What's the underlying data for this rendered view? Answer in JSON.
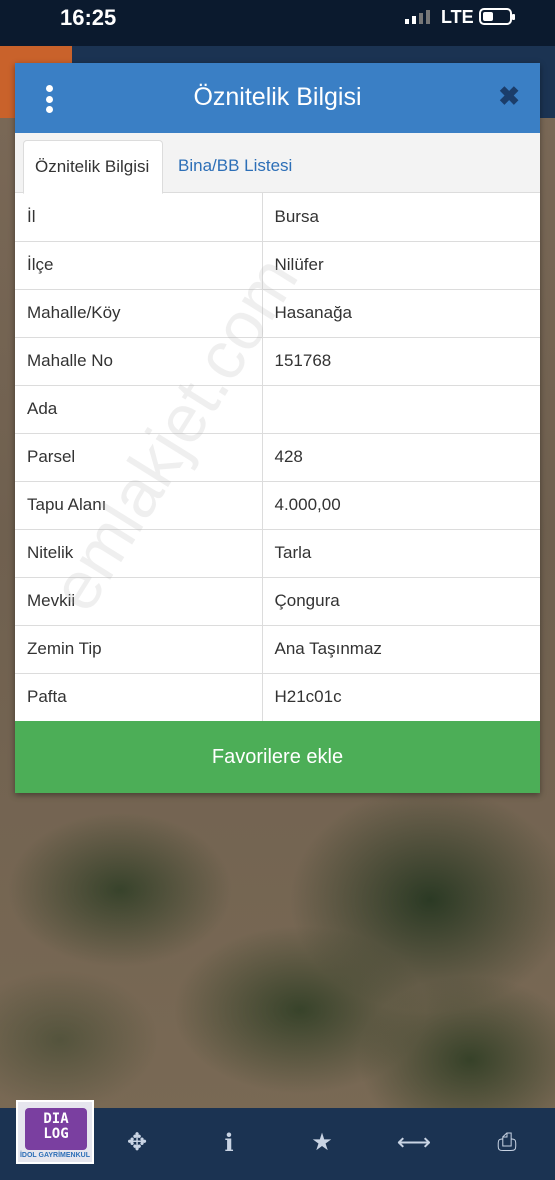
{
  "status_bar": {
    "time": "16:25",
    "network": "LTE"
  },
  "modal": {
    "title": "Öznitelik Bilgisi",
    "tabs": [
      {
        "label": "Öznitelik Bilgisi",
        "active": true
      },
      {
        "label": "Bina/BB Listesi",
        "active": false
      }
    ],
    "rows": [
      {
        "key": "İl",
        "value": "Bursa"
      },
      {
        "key": "İlçe",
        "value": "Nilüfer"
      },
      {
        "key": "Mahalle/Köy",
        "value": "Hasanağa"
      },
      {
        "key": "Mahalle No",
        "value": "151768"
      },
      {
        "key": "Ada",
        "value": ""
      },
      {
        "key": "Parsel",
        "value": "428"
      },
      {
        "key": "Tapu Alanı",
        "value": "4.000,00"
      },
      {
        "key": "Nitelik",
        "value": "Tarla"
      },
      {
        "key": "Mevkii",
        "value": "Çongura"
      },
      {
        "key": "Zemin Tip",
        "value": "Ana Taşınmaz"
      },
      {
        "key": "Pafta",
        "value": "H21c01c"
      }
    ],
    "favorite_button": "Favorilere ekle"
  },
  "watermark": "emlakjet.com",
  "logo": {
    "line1": "DIA",
    "line2": "LOG",
    "sub": "İDOL GAYRİMENKUL"
  },
  "toolbar_icons": [
    "crosshair-icon",
    "info-icon",
    "star-icon",
    "measure-icon",
    "print-icon"
  ],
  "colors": {
    "header_blue": "#3a7fc5",
    "button_green": "#4cae57",
    "link_blue": "#2d6fb7",
    "toolbar_navy": "#1b3352"
  }
}
